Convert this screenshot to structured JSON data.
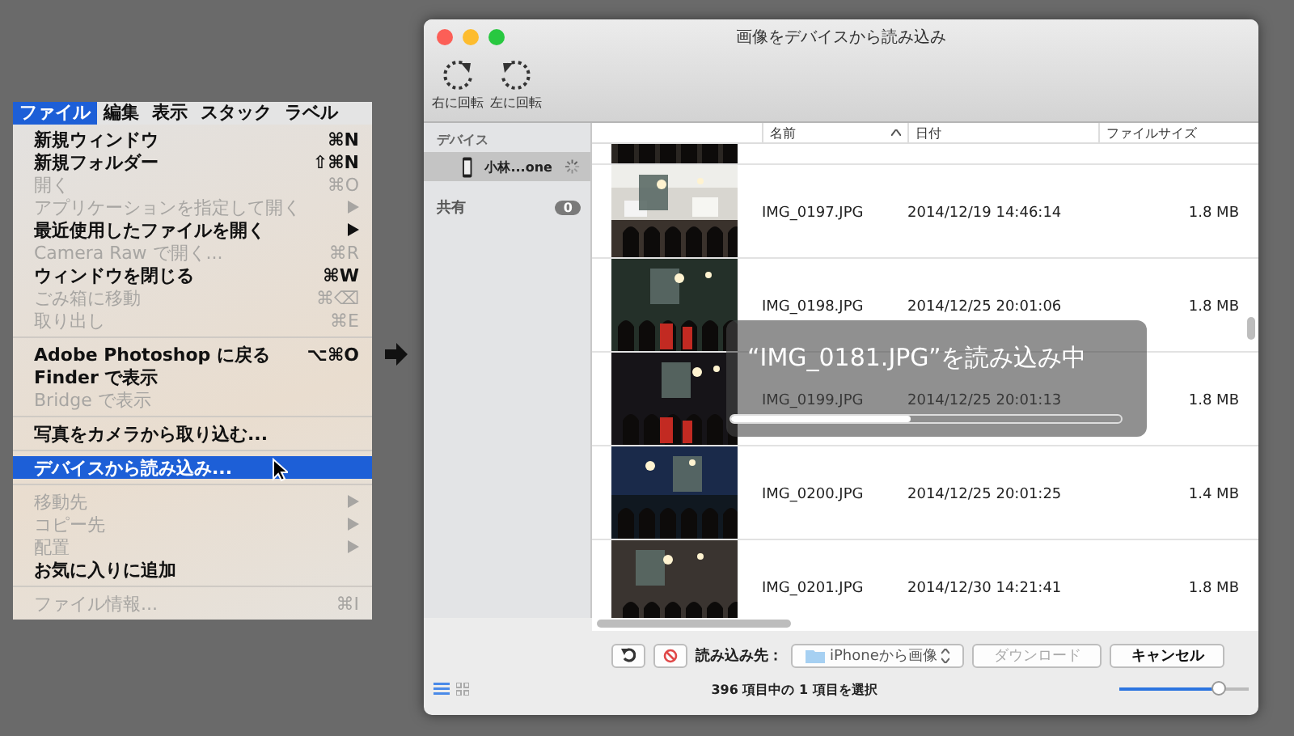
{
  "menu": {
    "menubar": [
      {
        "label": "ファイル",
        "selected": true
      },
      {
        "label": "編集",
        "selected": false
      },
      {
        "label": "表示",
        "selected": false
      },
      {
        "label": "スタック",
        "selected": false
      },
      {
        "label": "ラベル",
        "selected": false
      }
    ],
    "items": [
      {
        "kind": "item",
        "label": "新規ウィンドウ",
        "shortcut": "⌘N",
        "disabled": false,
        "submenu": false,
        "selected": false
      },
      {
        "kind": "item",
        "label": "新規フォルダー",
        "shortcut": "⇧⌘N",
        "disabled": false,
        "submenu": false,
        "selected": false
      },
      {
        "kind": "item",
        "label": "開く",
        "shortcut": "⌘O",
        "disabled": true,
        "submenu": false,
        "selected": false
      },
      {
        "kind": "item",
        "label": "アプリケーションを指定して開く",
        "disabled": true,
        "submenu": true,
        "selected": false
      },
      {
        "kind": "item",
        "label": "最近使用したファイルを開く",
        "disabled": false,
        "submenu": true,
        "selected": false
      },
      {
        "kind": "item",
        "label": "Camera Raw で開く...",
        "shortcut": "⌘R",
        "disabled": true,
        "submenu": false,
        "selected": false
      },
      {
        "kind": "item",
        "label": "ウィンドウを閉じる",
        "shortcut": "⌘W",
        "disabled": false,
        "submenu": false,
        "selected": false
      },
      {
        "kind": "item",
        "label": "ごみ箱に移動",
        "shortcut": "⌘⌫",
        "disabled": true,
        "submenu": false,
        "selected": false
      },
      {
        "kind": "item",
        "label": "取り出し",
        "shortcut": "⌘E",
        "disabled": true,
        "submenu": false,
        "selected": false
      },
      {
        "kind": "separator"
      },
      {
        "kind": "item",
        "label": "Adobe Photoshop に戻る",
        "shortcut": "⌥⌘O",
        "disabled": false,
        "submenu": false,
        "selected": false
      },
      {
        "kind": "item",
        "label": "Finder で表示",
        "disabled": false,
        "submenu": false,
        "selected": false
      },
      {
        "kind": "item",
        "label": "Bridge で表示",
        "disabled": true,
        "submenu": false,
        "selected": false
      },
      {
        "kind": "separator"
      },
      {
        "kind": "item",
        "label": "写真をカメラから取り込む...",
        "disabled": false,
        "submenu": false,
        "selected": false
      },
      {
        "kind": "separator"
      },
      {
        "kind": "item",
        "label": "デバイスから読み込み...",
        "disabled": false,
        "submenu": false,
        "selected": true
      },
      {
        "kind": "separator"
      },
      {
        "kind": "item",
        "label": "移動先",
        "disabled": true,
        "submenu": true,
        "selected": false
      },
      {
        "kind": "item",
        "label": "コピー先",
        "disabled": true,
        "submenu": true,
        "selected": false
      },
      {
        "kind": "item",
        "label": "配置",
        "disabled": true,
        "submenu": true,
        "selected": false
      },
      {
        "kind": "item",
        "label": "お気に入りに追加",
        "disabled": false,
        "submenu": false,
        "selected": false
      },
      {
        "kind": "separator"
      },
      {
        "kind": "item",
        "label": "ファイル情報...",
        "shortcut": "⌘I",
        "disabled": true,
        "submenu": false,
        "selected": false
      }
    ]
  },
  "window": {
    "title": "画像をデバイスから読み込み",
    "toolbar": [
      {
        "kind": "rotate-right",
        "label": "右に回転"
      },
      {
        "kind": "rotate-left",
        "label": "左に回転"
      }
    ],
    "sidebar": {
      "devices_header": "デバイス",
      "devices": [
        {
          "label": "小林...one",
          "selected": true,
          "busy": true
        }
      ],
      "shared": {
        "label": "共有",
        "badge": "0"
      }
    },
    "table": {
      "columns": [
        {
          "label": "名前",
          "sorted": true
        },
        {
          "label": "日付",
          "sorted": false
        },
        {
          "label": "ファイルサイズ",
          "sorted": false
        }
      ],
      "rows": [
        {
          "kind": "partial"
        },
        {
          "kind": "file",
          "name": "IMG_0197.JPG",
          "date": "2014/12/19 14:46:14",
          "size": "1.8 MB"
        },
        {
          "kind": "file",
          "name": "IMG_0198.JPG",
          "date": "2014/12/25 20:01:06",
          "size": "1.8 MB"
        },
        {
          "kind": "file",
          "name": "IMG_0199.JPG",
          "date": "2014/12/25 20:01:13",
          "size": "1.8 MB"
        },
        {
          "kind": "file",
          "name": "IMG_0200.JPG",
          "date": "2014/12/25 20:01:25",
          "size": "1.4 MB"
        },
        {
          "kind": "file",
          "name": "IMG_0201.JPG",
          "date": "2014/12/30 14:21:41",
          "size": "1.8 MB"
        }
      ]
    },
    "progress": {
      "text": "“IMG_0181.JPG”を読み込み中",
      "level": 0.46
    },
    "bottom": {
      "import_to_label": "読み込み先：",
      "destination": "iPhoneから画像",
      "download": {
        "label": "ダウンロード",
        "disabled": true
      },
      "cancel": {
        "label": "キャンセル",
        "disabled": false
      }
    },
    "status": "396 項目中の 1 項目を選択",
    "view_modes": [
      {
        "kind": "list",
        "selected": true
      },
      {
        "kind": "grid",
        "selected": false
      }
    ],
    "thumbnail_size": {
      "level": 0.76
    }
  }
}
